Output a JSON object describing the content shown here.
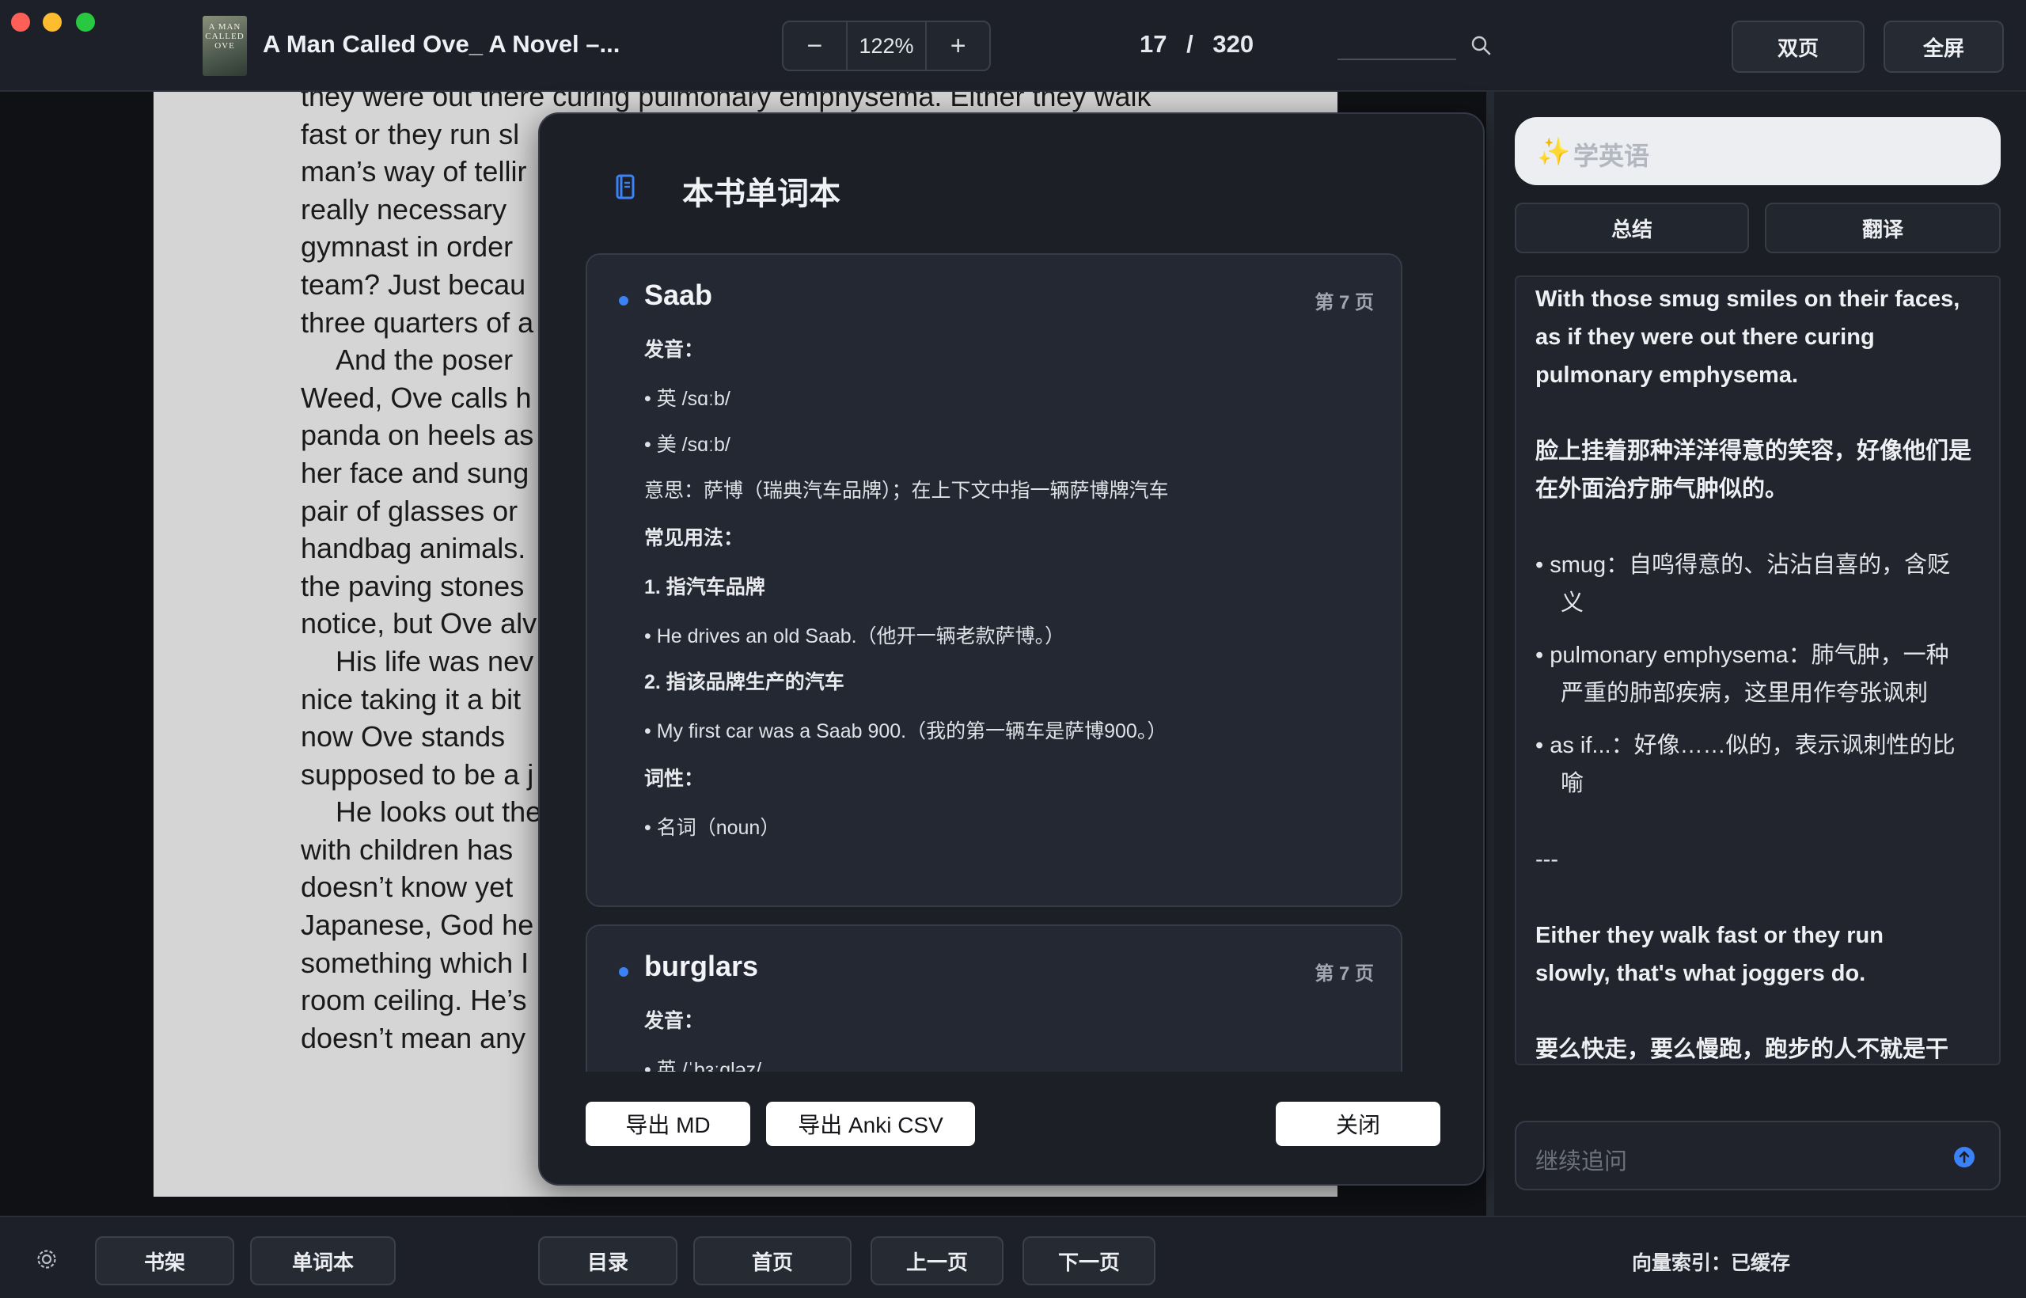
{
  "window": {
    "book_title": "A Man Called Ove_ A Novel –...",
    "cover_text": "A MAN CALLED OVE"
  },
  "toolbar": {
    "zoom_minus": "−",
    "zoom_value": "122%",
    "zoom_plus": "+",
    "page_current": "17",
    "page_sep": "/",
    "page_total": "320",
    "double_page": "双页",
    "fullscreen": "全屏"
  },
  "icons": {
    "search": "search-icon",
    "book": "book-icon",
    "sparkle": "sparkle-icon",
    "send": "send-icon",
    "settings": "gear-icon"
  },
  "book_page": {
    "lines": [
      "they were out there curing pulmonary emphysema. Either they walk",
      "fast or they run sl",
      "man’s way of tellir",
      "really  necessary",
      "gymnast in order",
      "team? Just becau",
      "three quarters of a",
      "And  the  poser",
      "Weed, Ove calls h",
      "panda on heels as",
      "her face and sung",
      "pair of glasses or",
      "handbag  animals.",
      "the paving stones",
      "notice, but Ove alv",
      "His life was nev",
      "nice taking it a bit",
      "now  Ove  stands",
      "supposed to be a j",
      "He looks out the",
      "with  children  has",
      "doesn’t  know  yet",
      "Japanese, God he",
      "something which I",
      "room  ceiling.  He’s",
      "doesn’t mean any"
    ]
  },
  "vocab_modal": {
    "title": "本书单词本",
    "entries": [
      {
        "word": "Saab",
        "page": "第 7 页",
        "pron_label": "发音：",
        "pron_uk": "• 英 /sɑːb/",
        "pron_us": "• 美 /sɑːb/",
        "meaning": "意思：萨博（瑞典汽车品牌）；在上下文中指一辆萨博牌汽车",
        "usage_label": "常见用法：",
        "usage_1_title": "1. 指汽车品牌",
        "usage_1_example": "• He drives an old Saab.（他开一辆老款萨博。）",
        "usage_2_title": "2. 指该品牌生产的汽车",
        "usage_2_example": "• My first car was a Saab 900.（我的第一辆车是萨博900。）",
        "pos_label": "词性：",
        "pos_value": "• 名词（noun）"
      },
      {
        "word": "burglars",
        "page": "第 7 页",
        "pron_label": "发音：",
        "pron_uk": "• 英 /ˈbɜːɡləz/"
      }
    ],
    "export_md": "导出 MD",
    "export_anki": "导出 Anki CSV",
    "close": "关闭"
  },
  "right_panel": {
    "ai_placeholder": "学英语",
    "sparkle_glyph": "✨",
    "btn_summary": "总结",
    "btn_translate": "翻译",
    "content_lines": [
      {
        "text": "With those smug smiles on their faces,",
        "bold": true
      },
      {
        "text": "as if they were out there curing",
        "bold": true
      },
      {
        "text": "pulmonary emphysema.",
        "bold": true
      },
      {
        "text": "脸上挂着那种洋洋得意的笑容，好像他们是",
        "bold": true
      },
      {
        "text": "在外面治疗肺气肿似的。",
        "bold": true
      },
      {
        "text": "• smug：自鸣得意的、沾沾自喜的，含贬",
        "bold": false
      },
      {
        "text": "义",
        "bold": false
      },
      {
        "text": "• pulmonary emphysema：肺气肿，一种",
        "bold": false
      },
      {
        "text": "严重的肺部疾病，这里用作夸张讽刺",
        "bold": false
      },
      {
        "text": "• as if...：好像……似的，表示讽刺性的比",
        "bold": false
      },
      {
        "text": "喻",
        "bold": false
      },
      {
        "text": "---",
        "bold": false
      },
      {
        "text": "Either they walk fast or they run",
        "bold": true
      },
      {
        "text": "slowly, that's what joggers do.",
        "bold": true
      },
      {
        "text": "要么快走，要么慢跑，跑步的人不就是干",
        "bold": true
      }
    ],
    "followup_placeholder": "继续追问"
  },
  "bottom_bar": {
    "bookshelf": "书架",
    "vocab": "单词本",
    "toc": "目录",
    "home": "首页",
    "prev": "上一页",
    "next": "下一页",
    "index_status": "向量索引：已缓存"
  },
  "colors": {
    "accent": "#3b82f6",
    "background": "#14171d",
    "panel": "#1b1e25"
  }
}
